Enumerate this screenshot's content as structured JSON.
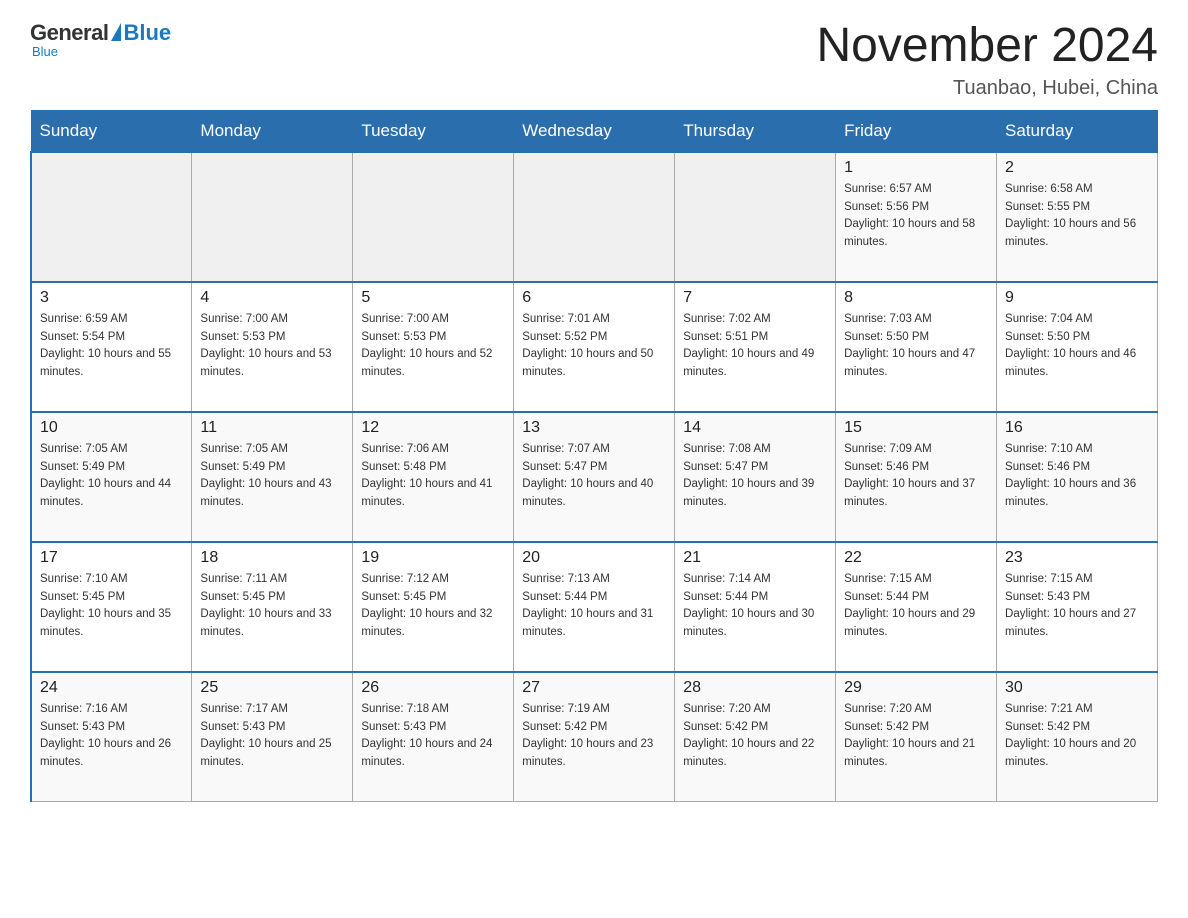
{
  "logo": {
    "general": "General",
    "blue": "Blue",
    "tagline": "Blue"
  },
  "header": {
    "title": "November 2024",
    "subtitle": "Tuanbao, Hubei, China"
  },
  "weekdays": [
    "Sunday",
    "Monday",
    "Tuesday",
    "Wednesday",
    "Thursday",
    "Friday",
    "Saturday"
  ],
  "weeks": [
    [
      {
        "day": "",
        "sunrise": "",
        "sunset": "",
        "daylight": ""
      },
      {
        "day": "",
        "sunrise": "",
        "sunset": "",
        "daylight": ""
      },
      {
        "day": "",
        "sunrise": "",
        "sunset": "",
        "daylight": ""
      },
      {
        "day": "",
        "sunrise": "",
        "sunset": "",
        "daylight": ""
      },
      {
        "day": "",
        "sunrise": "",
        "sunset": "",
        "daylight": ""
      },
      {
        "day": "1",
        "sunrise": "Sunrise: 6:57 AM",
        "sunset": "Sunset: 5:56 PM",
        "daylight": "Daylight: 10 hours and 58 minutes."
      },
      {
        "day": "2",
        "sunrise": "Sunrise: 6:58 AM",
        "sunset": "Sunset: 5:55 PM",
        "daylight": "Daylight: 10 hours and 56 minutes."
      }
    ],
    [
      {
        "day": "3",
        "sunrise": "Sunrise: 6:59 AM",
        "sunset": "Sunset: 5:54 PM",
        "daylight": "Daylight: 10 hours and 55 minutes."
      },
      {
        "day": "4",
        "sunrise": "Sunrise: 7:00 AM",
        "sunset": "Sunset: 5:53 PM",
        "daylight": "Daylight: 10 hours and 53 minutes."
      },
      {
        "day": "5",
        "sunrise": "Sunrise: 7:00 AM",
        "sunset": "Sunset: 5:53 PM",
        "daylight": "Daylight: 10 hours and 52 minutes."
      },
      {
        "day": "6",
        "sunrise": "Sunrise: 7:01 AM",
        "sunset": "Sunset: 5:52 PM",
        "daylight": "Daylight: 10 hours and 50 minutes."
      },
      {
        "day": "7",
        "sunrise": "Sunrise: 7:02 AM",
        "sunset": "Sunset: 5:51 PM",
        "daylight": "Daylight: 10 hours and 49 minutes."
      },
      {
        "day": "8",
        "sunrise": "Sunrise: 7:03 AM",
        "sunset": "Sunset: 5:50 PM",
        "daylight": "Daylight: 10 hours and 47 minutes."
      },
      {
        "day": "9",
        "sunrise": "Sunrise: 7:04 AM",
        "sunset": "Sunset: 5:50 PM",
        "daylight": "Daylight: 10 hours and 46 minutes."
      }
    ],
    [
      {
        "day": "10",
        "sunrise": "Sunrise: 7:05 AM",
        "sunset": "Sunset: 5:49 PM",
        "daylight": "Daylight: 10 hours and 44 minutes."
      },
      {
        "day": "11",
        "sunrise": "Sunrise: 7:05 AM",
        "sunset": "Sunset: 5:49 PM",
        "daylight": "Daylight: 10 hours and 43 minutes."
      },
      {
        "day": "12",
        "sunrise": "Sunrise: 7:06 AM",
        "sunset": "Sunset: 5:48 PM",
        "daylight": "Daylight: 10 hours and 41 minutes."
      },
      {
        "day": "13",
        "sunrise": "Sunrise: 7:07 AM",
        "sunset": "Sunset: 5:47 PM",
        "daylight": "Daylight: 10 hours and 40 minutes."
      },
      {
        "day": "14",
        "sunrise": "Sunrise: 7:08 AM",
        "sunset": "Sunset: 5:47 PM",
        "daylight": "Daylight: 10 hours and 39 minutes."
      },
      {
        "day": "15",
        "sunrise": "Sunrise: 7:09 AM",
        "sunset": "Sunset: 5:46 PM",
        "daylight": "Daylight: 10 hours and 37 minutes."
      },
      {
        "day": "16",
        "sunrise": "Sunrise: 7:10 AM",
        "sunset": "Sunset: 5:46 PM",
        "daylight": "Daylight: 10 hours and 36 minutes."
      }
    ],
    [
      {
        "day": "17",
        "sunrise": "Sunrise: 7:10 AM",
        "sunset": "Sunset: 5:45 PM",
        "daylight": "Daylight: 10 hours and 35 minutes."
      },
      {
        "day": "18",
        "sunrise": "Sunrise: 7:11 AM",
        "sunset": "Sunset: 5:45 PM",
        "daylight": "Daylight: 10 hours and 33 minutes."
      },
      {
        "day": "19",
        "sunrise": "Sunrise: 7:12 AM",
        "sunset": "Sunset: 5:45 PM",
        "daylight": "Daylight: 10 hours and 32 minutes."
      },
      {
        "day": "20",
        "sunrise": "Sunrise: 7:13 AM",
        "sunset": "Sunset: 5:44 PM",
        "daylight": "Daylight: 10 hours and 31 minutes."
      },
      {
        "day": "21",
        "sunrise": "Sunrise: 7:14 AM",
        "sunset": "Sunset: 5:44 PM",
        "daylight": "Daylight: 10 hours and 30 minutes."
      },
      {
        "day": "22",
        "sunrise": "Sunrise: 7:15 AM",
        "sunset": "Sunset: 5:44 PM",
        "daylight": "Daylight: 10 hours and 29 minutes."
      },
      {
        "day": "23",
        "sunrise": "Sunrise: 7:15 AM",
        "sunset": "Sunset: 5:43 PM",
        "daylight": "Daylight: 10 hours and 27 minutes."
      }
    ],
    [
      {
        "day": "24",
        "sunrise": "Sunrise: 7:16 AM",
        "sunset": "Sunset: 5:43 PM",
        "daylight": "Daylight: 10 hours and 26 minutes."
      },
      {
        "day": "25",
        "sunrise": "Sunrise: 7:17 AM",
        "sunset": "Sunset: 5:43 PM",
        "daylight": "Daylight: 10 hours and 25 minutes."
      },
      {
        "day": "26",
        "sunrise": "Sunrise: 7:18 AM",
        "sunset": "Sunset: 5:43 PM",
        "daylight": "Daylight: 10 hours and 24 minutes."
      },
      {
        "day": "27",
        "sunrise": "Sunrise: 7:19 AM",
        "sunset": "Sunset: 5:42 PM",
        "daylight": "Daylight: 10 hours and 23 minutes."
      },
      {
        "day": "28",
        "sunrise": "Sunrise: 7:20 AM",
        "sunset": "Sunset: 5:42 PM",
        "daylight": "Daylight: 10 hours and 22 minutes."
      },
      {
        "day": "29",
        "sunrise": "Sunrise: 7:20 AM",
        "sunset": "Sunset: 5:42 PM",
        "daylight": "Daylight: 10 hours and 21 minutes."
      },
      {
        "day": "30",
        "sunrise": "Sunrise: 7:21 AM",
        "sunset": "Sunset: 5:42 PM",
        "daylight": "Daylight: 10 hours and 20 minutes."
      }
    ]
  ]
}
